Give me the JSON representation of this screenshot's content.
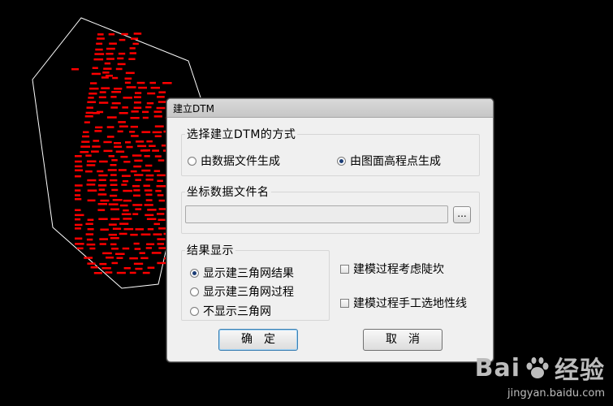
{
  "dialog": {
    "title": "建立DTM",
    "method_group": {
      "label": "选择建立DTM的方式",
      "options": [
        "由数据文件生成",
        "由图面高程点生成"
      ],
      "selected": 1
    },
    "file_group": {
      "label": "坐标数据文件名",
      "path_value": "",
      "browse_label": "..."
    },
    "result_group": {
      "label": "结果显示",
      "options": [
        "显示建三角网结果",
        "显示建三角网过程",
        "不显示三角网"
      ],
      "selected": 0
    },
    "checkboxes": [
      {
        "label": "建模过程考虑陡坎",
        "checked": false
      },
      {
        "label": "建模过程手工选地性线",
        "checked": false
      }
    ],
    "ok_label": "确定",
    "cancel_label": "取消"
  },
  "watermark": {
    "logo_text": "Bai",
    "logo_suffix": "经验",
    "url": "jingyan.baidu.com"
  },
  "colors": {
    "background": "#000000",
    "boundary": "#ffffff",
    "points": "#ff0000"
  }
}
